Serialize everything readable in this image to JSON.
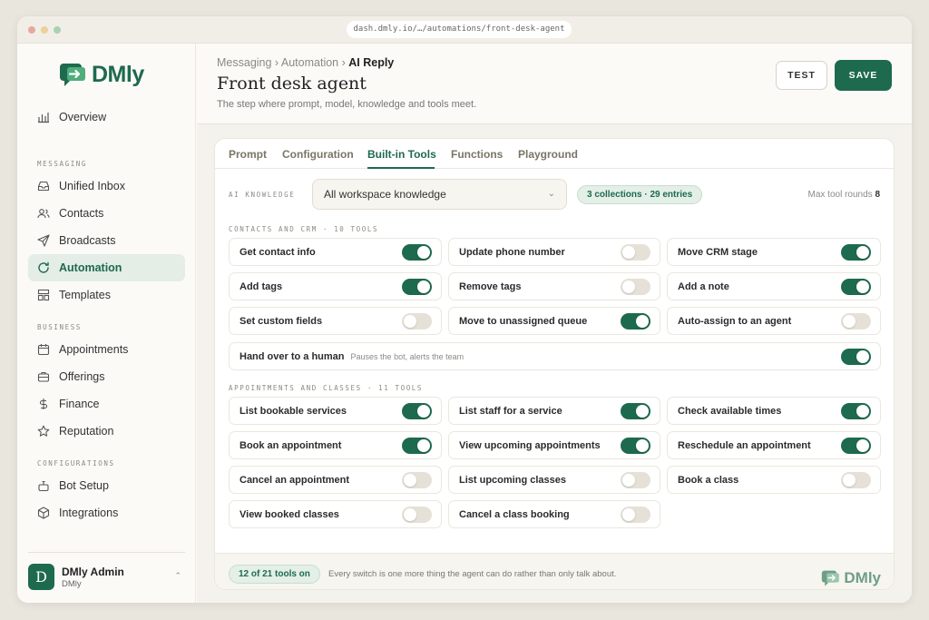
{
  "browser": {
    "url": "dash.dmly.io/…/automations/front-desk-agent"
  },
  "brand": {
    "name": "DMly",
    "color": "#1e6a4f"
  },
  "sidebar": {
    "top_item": {
      "label": "Overview",
      "icon": "chart-bar-icon"
    },
    "sections": [
      {
        "title": "MESSAGING",
        "items": [
          {
            "label": "Unified Inbox",
            "icon": "inbox-icon"
          },
          {
            "label": "Contacts",
            "icon": "users-icon"
          },
          {
            "label": "Broadcasts",
            "icon": "send-icon"
          },
          {
            "label": "Automation",
            "icon": "refresh-icon",
            "active": true
          },
          {
            "label": "Templates",
            "icon": "layout-icon"
          }
        ]
      },
      {
        "title": "BUSINESS",
        "items": [
          {
            "label": "Appointments",
            "icon": "calendar-icon"
          },
          {
            "label": "Offerings",
            "icon": "briefcase-icon"
          },
          {
            "label": "Finance",
            "icon": "dollar-icon"
          },
          {
            "label": "Reputation",
            "icon": "star-icon"
          }
        ]
      },
      {
        "title": "CONFIGURATIONS",
        "items": [
          {
            "label": "Bot Setup",
            "icon": "bot-icon"
          },
          {
            "label": "Integrations",
            "icon": "cube-icon"
          }
        ]
      }
    ],
    "user": {
      "initial": "D",
      "name": "DMly Admin",
      "org": "DMly"
    }
  },
  "header": {
    "breadcrumbs": [
      "Messaging ›",
      "Automation ›",
      "AI Reply"
    ],
    "title": "Front desk agent",
    "subtitle": "The step where prompt, model, knowledge and tools meet.",
    "test_label": "TEST",
    "save_label": "SAVE"
  },
  "tabs": [
    "Prompt",
    "Configuration",
    "Built-in Tools",
    "Functions",
    "Playground"
  ],
  "active_tab": "Built-in Tools",
  "knowledge": {
    "label": "AI KNOWLEDGE",
    "selected": "All workspace knowledge",
    "badge": "3 collections · 29 entries",
    "max_rounds_label": "Max tool rounds",
    "max_rounds_value": "8"
  },
  "groups": [
    {
      "title": "CONTACTS AND CRM · 10 TOOLS",
      "tools": [
        {
          "label": "Get contact info",
          "on": true
        },
        {
          "label": "Update phone number",
          "on": false
        },
        {
          "label": "Move CRM stage",
          "on": true
        },
        {
          "label": "Add tags",
          "on": true
        },
        {
          "label": "Remove tags",
          "on": false
        },
        {
          "label": "Add a note",
          "on": true
        },
        {
          "label": "Set custom fields",
          "on": false
        },
        {
          "label": "Move to unassigned queue",
          "on": true
        },
        {
          "label": "Auto-assign to an agent",
          "on": false
        },
        {
          "label": "Hand over to a human",
          "description": "Pauses the bot, alerts the team",
          "on": true,
          "wide": true
        }
      ]
    },
    {
      "title": "APPOINTMENTS AND CLASSES · 11 TOOLS",
      "tools": [
        {
          "label": "List bookable services",
          "on": true
        },
        {
          "label": "List staff for a service",
          "on": true
        },
        {
          "label": "Check available times",
          "on": true
        },
        {
          "label": "Book an appointment",
          "on": true
        },
        {
          "label": "View upcoming appointments",
          "on": true
        },
        {
          "label": "Reschedule an appointment",
          "on": true
        },
        {
          "label": "Cancel an appointment",
          "on": false
        },
        {
          "label": "List upcoming classes",
          "on": false
        },
        {
          "label": "Book a class",
          "on": false
        },
        {
          "label": "View booked classes",
          "on": false
        },
        {
          "label": "Cancel a class booking",
          "on": false
        }
      ]
    }
  ],
  "footer": {
    "count": "12 of 21 tools on",
    "note": "Every switch is one more thing the agent can do rather than only talk about."
  }
}
